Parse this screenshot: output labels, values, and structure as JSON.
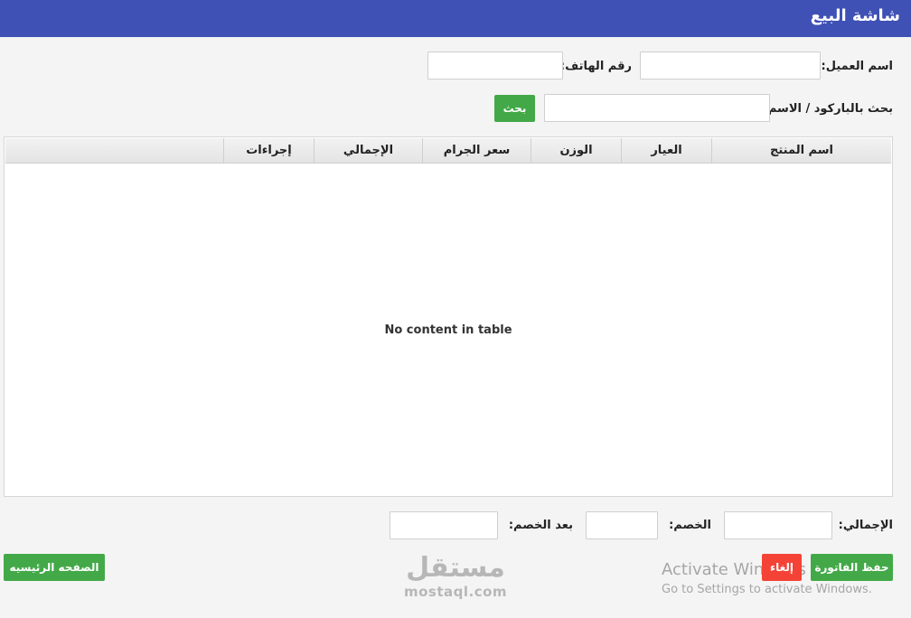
{
  "header": {
    "title": "شاشة البيع"
  },
  "form": {
    "customer_name_label": "اسم العميل:",
    "phone_label": "رقم الهاتف:",
    "search_label": "بحث بالباركود / الاسم:",
    "search_button": "بحث"
  },
  "table": {
    "columns": [
      "اسم المنتج",
      "العيار",
      "الوزن",
      "سعر الجرام",
      "الإجمالي",
      "إجراءات"
    ],
    "empty_message": "No content in table"
  },
  "totals": {
    "total_label": "الإجمالي:",
    "discount_label": "الخصم:",
    "after_discount_label": "بعد الخصم:"
  },
  "actions": {
    "save_invoice": "حفظ الفاتورة",
    "cancel": "إلغاء",
    "home": "الصفحه الرئيسيه"
  },
  "watermark": {
    "line1": "Activate Windows",
    "line2": "Go to Settings to activate Windows."
  },
  "logo": {
    "arabic": "مستقل",
    "latin": "mostaql.com"
  },
  "colors": {
    "header_bg": "#3f51b5",
    "button_green": "#43a948",
    "button_red": "#f44336",
    "page_bg": "#f4f4f4"
  }
}
